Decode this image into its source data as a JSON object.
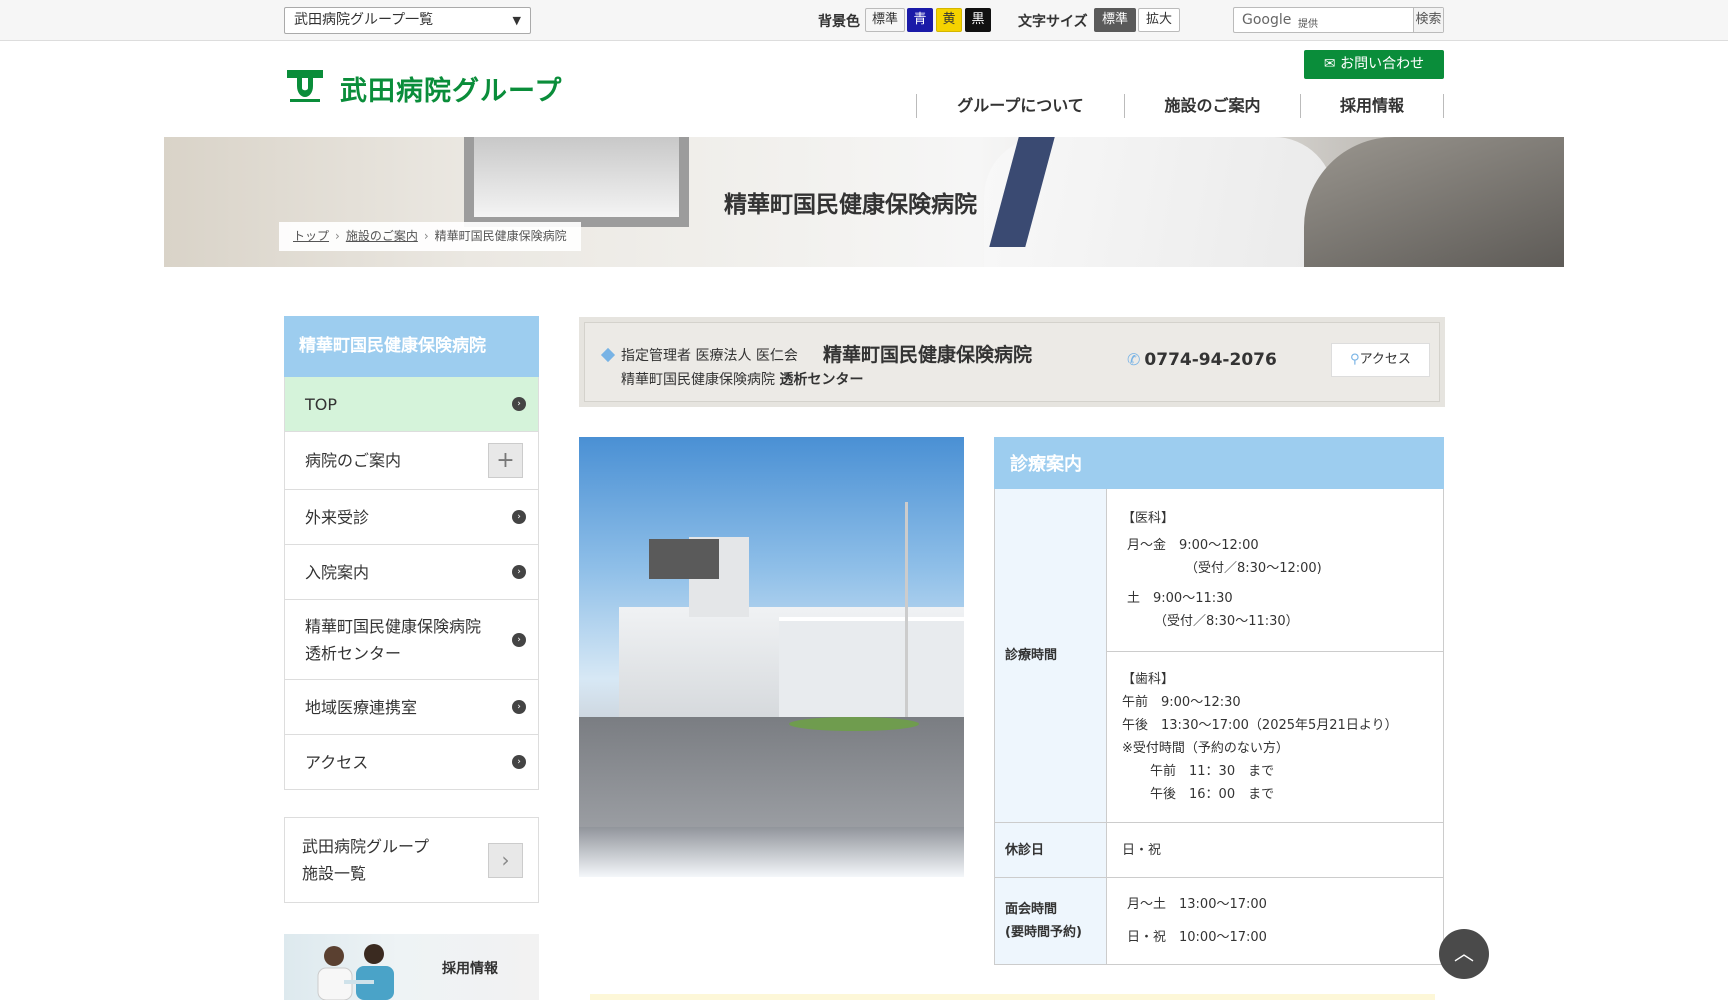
{
  "topbar": {
    "group_select": "武田病院グループ一覧",
    "bg_label": "背景色",
    "bg_options": [
      {
        "label": "標準",
        "bg": "#ffffff",
        "fg": "#333333"
      },
      {
        "label": "青",
        "bg": "#1a1aa8",
        "fg": "#ffffff"
      },
      {
        "label": "黄",
        "bg": "#f5d200",
        "fg": "#333333"
      },
      {
        "label": "黒",
        "bg": "#111111",
        "fg": "#ffffff"
      }
    ],
    "font_label": "文字サイズ",
    "font_options": [
      {
        "label": "標準",
        "bg": "#5a5a5a",
        "fg": "#ffffff"
      },
      {
        "label": "拡大",
        "bg": "#ffffff",
        "fg": "#333333"
      }
    ],
    "search": {
      "google": "Google",
      "provided": "提供",
      "button": "検索"
    }
  },
  "header": {
    "logo_text": "武田病院グループ",
    "contact_label": "お問い合わせ",
    "nav": [
      "グループについて",
      "施設のご案内",
      "採用情報"
    ]
  },
  "hero": {
    "title": "精華町国民健康保険病院",
    "breadcrumb": [
      "トップ",
      "施設のご案内",
      "精華町国民健康保険病院"
    ]
  },
  "sidebar": {
    "heading": "精華町国民健康保険病院",
    "items": [
      {
        "label": "TOP"
      },
      {
        "label": "病院のご案内"
      },
      {
        "label": "外来受診"
      },
      {
        "label": "入院案内"
      },
      {
        "label": "精華町国民健康保険病院",
        "label2": "透析センター"
      },
      {
        "label": "地域医療連携室"
      },
      {
        "label": "アクセス"
      }
    ],
    "group_list": {
      "line1": "武田病院グループ",
      "line2": "施設一覧"
    },
    "recruit": "採用情報"
  },
  "info": {
    "manager": "指定管理者 医療法人 医仁会",
    "hospital": "精華町国民健康保険病院",
    "sub_prefix": "精華町国民健康保険病院",
    "sub_bold": "透析センター",
    "phone": "0774-94-2076",
    "access": "アクセス"
  },
  "schedule": {
    "title": "診療案内",
    "hours_label": "診療時間",
    "medical": {
      "head": "【医科】",
      "weekday": "月～金　9:00～12:00",
      "weekday_recv": "（受付／8:30～12:00)",
      "sat": "土　9:00～11:30",
      "sat_recv": "（受付／8:30〜11:30）"
    },
    "dental": {
      "head": "【歯科】",
      "am": "午前　9:00～12:30",
      "pm": "午後　13:30〜17:00（2025年5月21日より）",
      "note": "※受付時間（予約のない方）",
      "note_am": "午前　11：30　まで",
      "note_pm": "午後　16：00　まで"
    },
    "closed_label": "休診日",
    "closed_value": "日・祝",
    "visit_label": "面会時間",
    "visit_label2": "(要時間予約)",
    "visit_weekday": "月〜土　13:00～17:00",
    "visit_holiday": "日・祝　10:00〜17:00"
  },
  "colors": {
    "brand_green": "#0a8d3a",
    "accent_blue": "#9dcdef",
    "holiday_red": "#e02020"
  }
}
